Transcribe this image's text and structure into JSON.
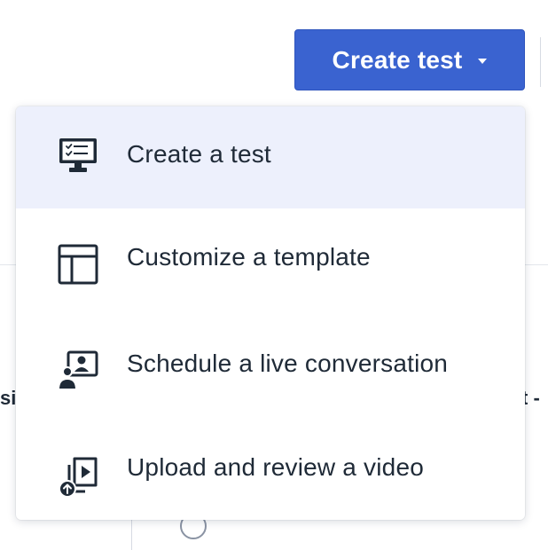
{
  "header": {
    "create_button_label": "Create test"
  },
  "background": {
    "partial_left_text": "si",
    "partial_right_text": "t -"
  },
  "menu": {
    "items": [
      {
        "label": "Create a test",
        "icon": "monitor-checklist-icon",
        "active": true
      },
      {
        "label": "Customize a template",
        "icon": "template-layout-icon",
        "active": false
      },
      {
        "label": "Schedule a live conversation",
        "icon": "live-conversation-icon",
        "active": false
      },
      {
        "label": "Upload and review a video",
        "icon": "upload-video-icon",
        "active": false
      }
    ]
  },
  "colors": {
    "accent": "#3a63d0",
    "active_item_bg": "#edf0fc",
    "icon_color": "#1f2a37"
  }
}
